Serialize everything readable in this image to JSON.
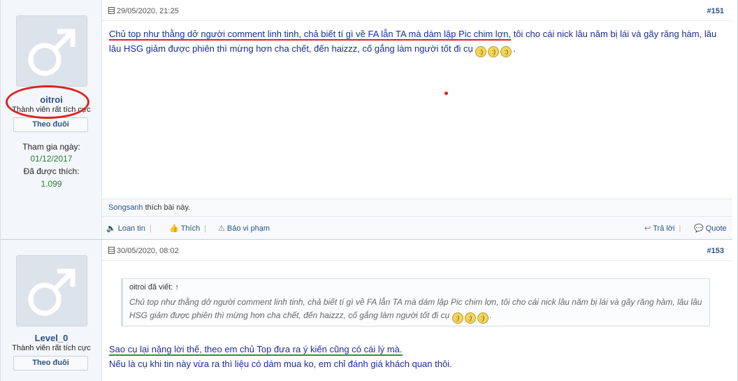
{
  "posts": [
    {
      "user": {
        "name": "oitroi",
        "title": "Thành viên rất tích cực",
        "follow_label": "Theo đuôi",
        "joined_label": "Tham gia ngày:",
        "joined_value": "01/12/2017",
        "likes_label": "Đã được thích:",
        "likes_value": "1.099"
      },
      "date": "29/05/2020, 21:25",
      "number": "#151",
      "body_underlined": "Chủ top như thằng dở người comment linh tinh, chả biết tí gì về FA lẫn TA mà dám lập Pic chim lợn,",
      "body_rest": " tôi cho cái nick lâu năm bị lái và gãy răng hàm, lâu lâu HSG giảm được phiên thì mừng hơn cha chết, đến haizzz, cố gắng làm người tốt đi cụ",
      "body_end": ".",
      "liked_by": "Songsanh",
      "liked_suffix": " thích bài này.",
      "actions": {
        "report_spam": "Loan tin",
        "like": "Thích",
        "report": "Báo vi phạm",
        "reply": "Trả lời",
        "quote": "Quote"
      }
    },
    {
      "user": {
        "name": "Level_0",
        "title": "Thành viên rất tích cực",
        "follow_label": "Theo đuôi"
      },
      "date": "30/05/2020, 08:02",
      "number": "#153",
      "quote_attr": "oitroi đã viết: ↑",
      "quote_text": "Chủ top như thằng dở người comment linh tinh, chả biết tí gì về FA lẫn TA mà dám lập Pic chim lợn, tôi cho cái nick lâu năm bị lái và gãy răng hàm, lâu lâu HSG giảm được phiên thì mừng hơn cha chết, đến haizzz, cố gắng làm người tốt đi cụ",
      "quote_end": ".",
      "body_line1": "Sao cụ lại nặng lời thế, theo em chủ Top đưa ra ý kiến cũng có cái lý mà.",
      "body_line2": "Nếu là cụ khi tin này vừa ra thì liệu có dám mua ko, em chỉ đánh giá khách quan thôi."
    }
  ],
  "icons": {
    "avatar": "male-symbol-icon",
    "date": "post-icon",
    "smiley": "smiley-icon",
    "speaker": "speaker-icon",
    "like": "thumb-icon",
    "warning": "warning-icon",
    "reply": "reply-icon",
    "quote": "quote-icon"
  },
  "colors": {
    "link": "#2a5288",
    "message_text": "#1e2a9a",
    "annotation_red": "#e02020",
    "annotation_green": "#1f9a3c",
    "stat_value": "#2e7d32"
  }
}
